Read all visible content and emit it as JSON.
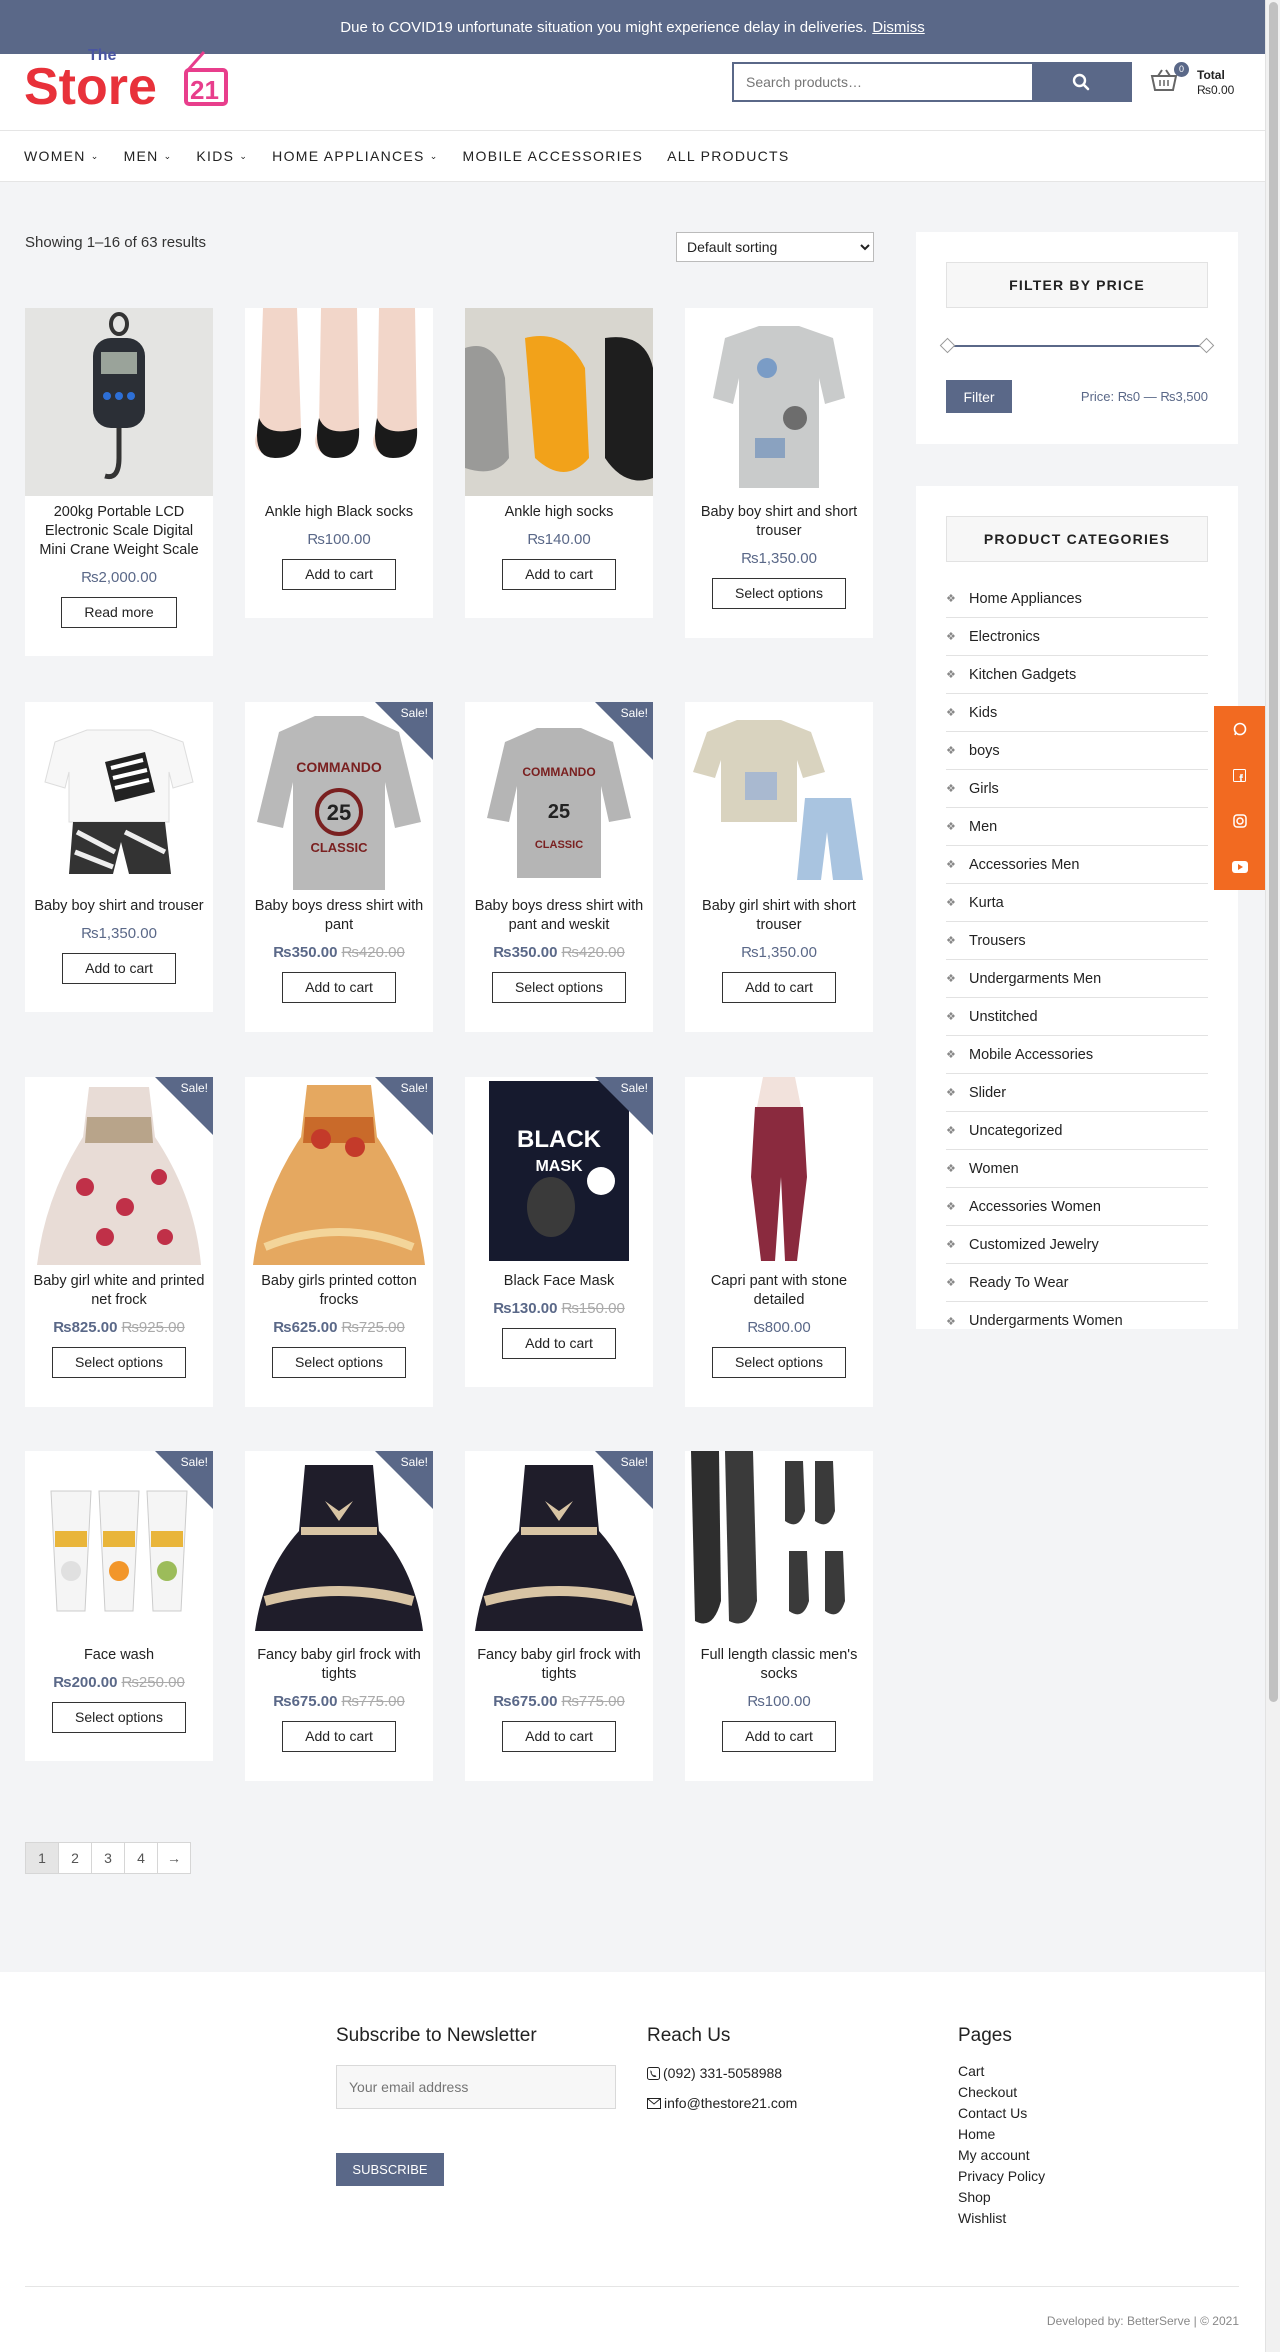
{
  "notice": {
    "text": "Due to COVID19 unfortunate situation you might experience delay in deliveries.",
    "dismiss": "Dismiss"
  },
  "logo": {
    "the": "The",
    "store": "Store",
    "num": "21"
  },
  "search": {
    "placeholder": "Search products…"
  },
  "cart": {
    "count": "0",
    "total_label": "Total",
    "amount": "₨0.00"
  },
  "nav": [
    {
      "label": "WOMEN",
      "chevron": "⌄"
    },
    {
      "label": "MEN",
      "chevron": "⌄"
    },
    {
      "label": "KIDS",
      "chevron": "⌄"
    },
    {
      "label": "HOME APPLIANCES",
      "chevron": "⌄"
    },
    {
      "label": "MOBILE ACCESSORIES"
    },
    {
      "label": "ALL PRODUCTS"
    }
  ],
  "results": "Showing 1–16 of 63 results",
  "sorting": "Default sorting",
  "products": [
    {
      "title": "200kg Portable LCD Electronic Scale Digital Mini Crane Weight Scale",
      "price": "₨2,000.00",
      "button": "Read more"
    },
    {
      "title": "Ankle high Black socks",
      "price": "₨100.00",
      "button": "Add to cart"
    },
    {
      "title": "Ankle high socks",
      "price": "₨140.00",
      "button": "Add to cart"
    },
    {
      "title": "Baby boy shirt and short trouser",
      "price": "₨1,350.00",
      "button": "Select options"
    },
    {
      "title": "Baby boy shirt and trouser",
      "price": "₨1,350.00",
      "button": "Add to cart"
    },
    {
      "title": "Baby boys dress shirt with pant",
      "price": "₨350.00",
      "old_price": "₨420.00",
      "sale": "Sale!",
      "button": "Add to cart"
    },
    {
      "title": "Baby boys dress shirt with pant and weskit",
      "price": "₨350.00",
      "old_price": "₨420.00",
      "sale": "Sale!",
      "button": "Select options"
    },
    {
      "title": "Baby girl shirt with short trouser",
      "price": "₨1,350.00",
      "button": "Add to cart"
    },
    {
      "title": "Baby girl white and printed net frock",
      "price": "₨825.00",
      "old_price": "₨925.00",
      "sale": "Sale!",
      "button": "Select options"
    },
    {
      "title": "Baby girls printed cotton frocks",
      "price": "₨625.00",
      "old_price": "₨725.00",
      "sale": "Sale!",
      "button": "Select options"
    },
    {
      "title": "Black Face Mask",
      "price": "₨130.00",
      "old_price": "₨150.00",
      "sale": "Sale!",
      "button": "Add to cart"
    },
    {
      "title": "Capri pant with stone detailed",
      "price": "₨800.00",
      "button": "Select options"
    },
    {
      "title": "Face wash",
      "price": "₨200.00",
      "old_price": "₨250.00",
      "sale": "Sale!",
      "button": "Select options"
    },
    {
      "title": "Fancy baby girl frock with tights",
      "price": "₨675.00",
      "old_price": "₨775.00",
      "sale": "Sale!",
      "button": "Add to cart"
    },
    {
      "title": "Fancy baby girl frock with tights",
      "price": "₨675.00",
      "old_price": "₨775.00",
      "sale": "Sale!",
      "button": "Add to cart"
    },
    {
      "title": "Full length classic men's socks",
      "price": "₨100.00",
      "button": "Add to cart"
    }
  ],
  "pagination": [
    "1",
    "2",
    "3",
    "4",
    "→"
  ],
  "filter_widget": {
    "title": "FILTER BY PRICE",
    "button": "Filter",
    "price_label": "Price: ₨0 — ₨3,500"
  },
  "categories_widget": {
    "title": "PRODUCT CATEGORIES",
    "items": [
      "Home Appliances",
      "Electronics",
      "Kitchen Gadgets",
      "Kids",
      "boys",
      "Girls",
      "Men",
      "Accessories Men",
      "Kurta",
      "Trousers",
      "Undergarments Men",
      "Unstitched",
      "Mobile Accessories",
      "Slider",
      "Uncategorized",
      "Women",
      "Accessories Women",
      "Customized Jewelry",
      "Ready To Wear",
      "Undergarments Women"
    ]
  },
  "social": [
    "whatsapp-icon",
    "facebook-icon",
    "instagram-icon",
    "youtube-icon"
  ],
  "footer": {
    "newsletter_title": "Subscribe to Newsletter",
    "email_placeholder": "Your email address",
    "subscribe": "SUBSCRIBE",
    "reach_title": "Reach Us",
    "phone": "(092) 331-5058988",
    "email": "info@thestore21.com",
    "pages_title": "Pages",
    "pages": [
      "Cart",
      "Checkout",
      "Contact Us",
      "Home",
      "My account",
      "Privacy Policy",
      "Shop",
      "Wishlist"
    ],
    "credit": "Developed by: BetterServe | © 2021"
  },
  "colors": {
    "accent": "#5a6888",
    "social": "#f26a21",
    "logo_red": "#e8313a",
    "logo_pink": "#e83e8c"
  }
}
